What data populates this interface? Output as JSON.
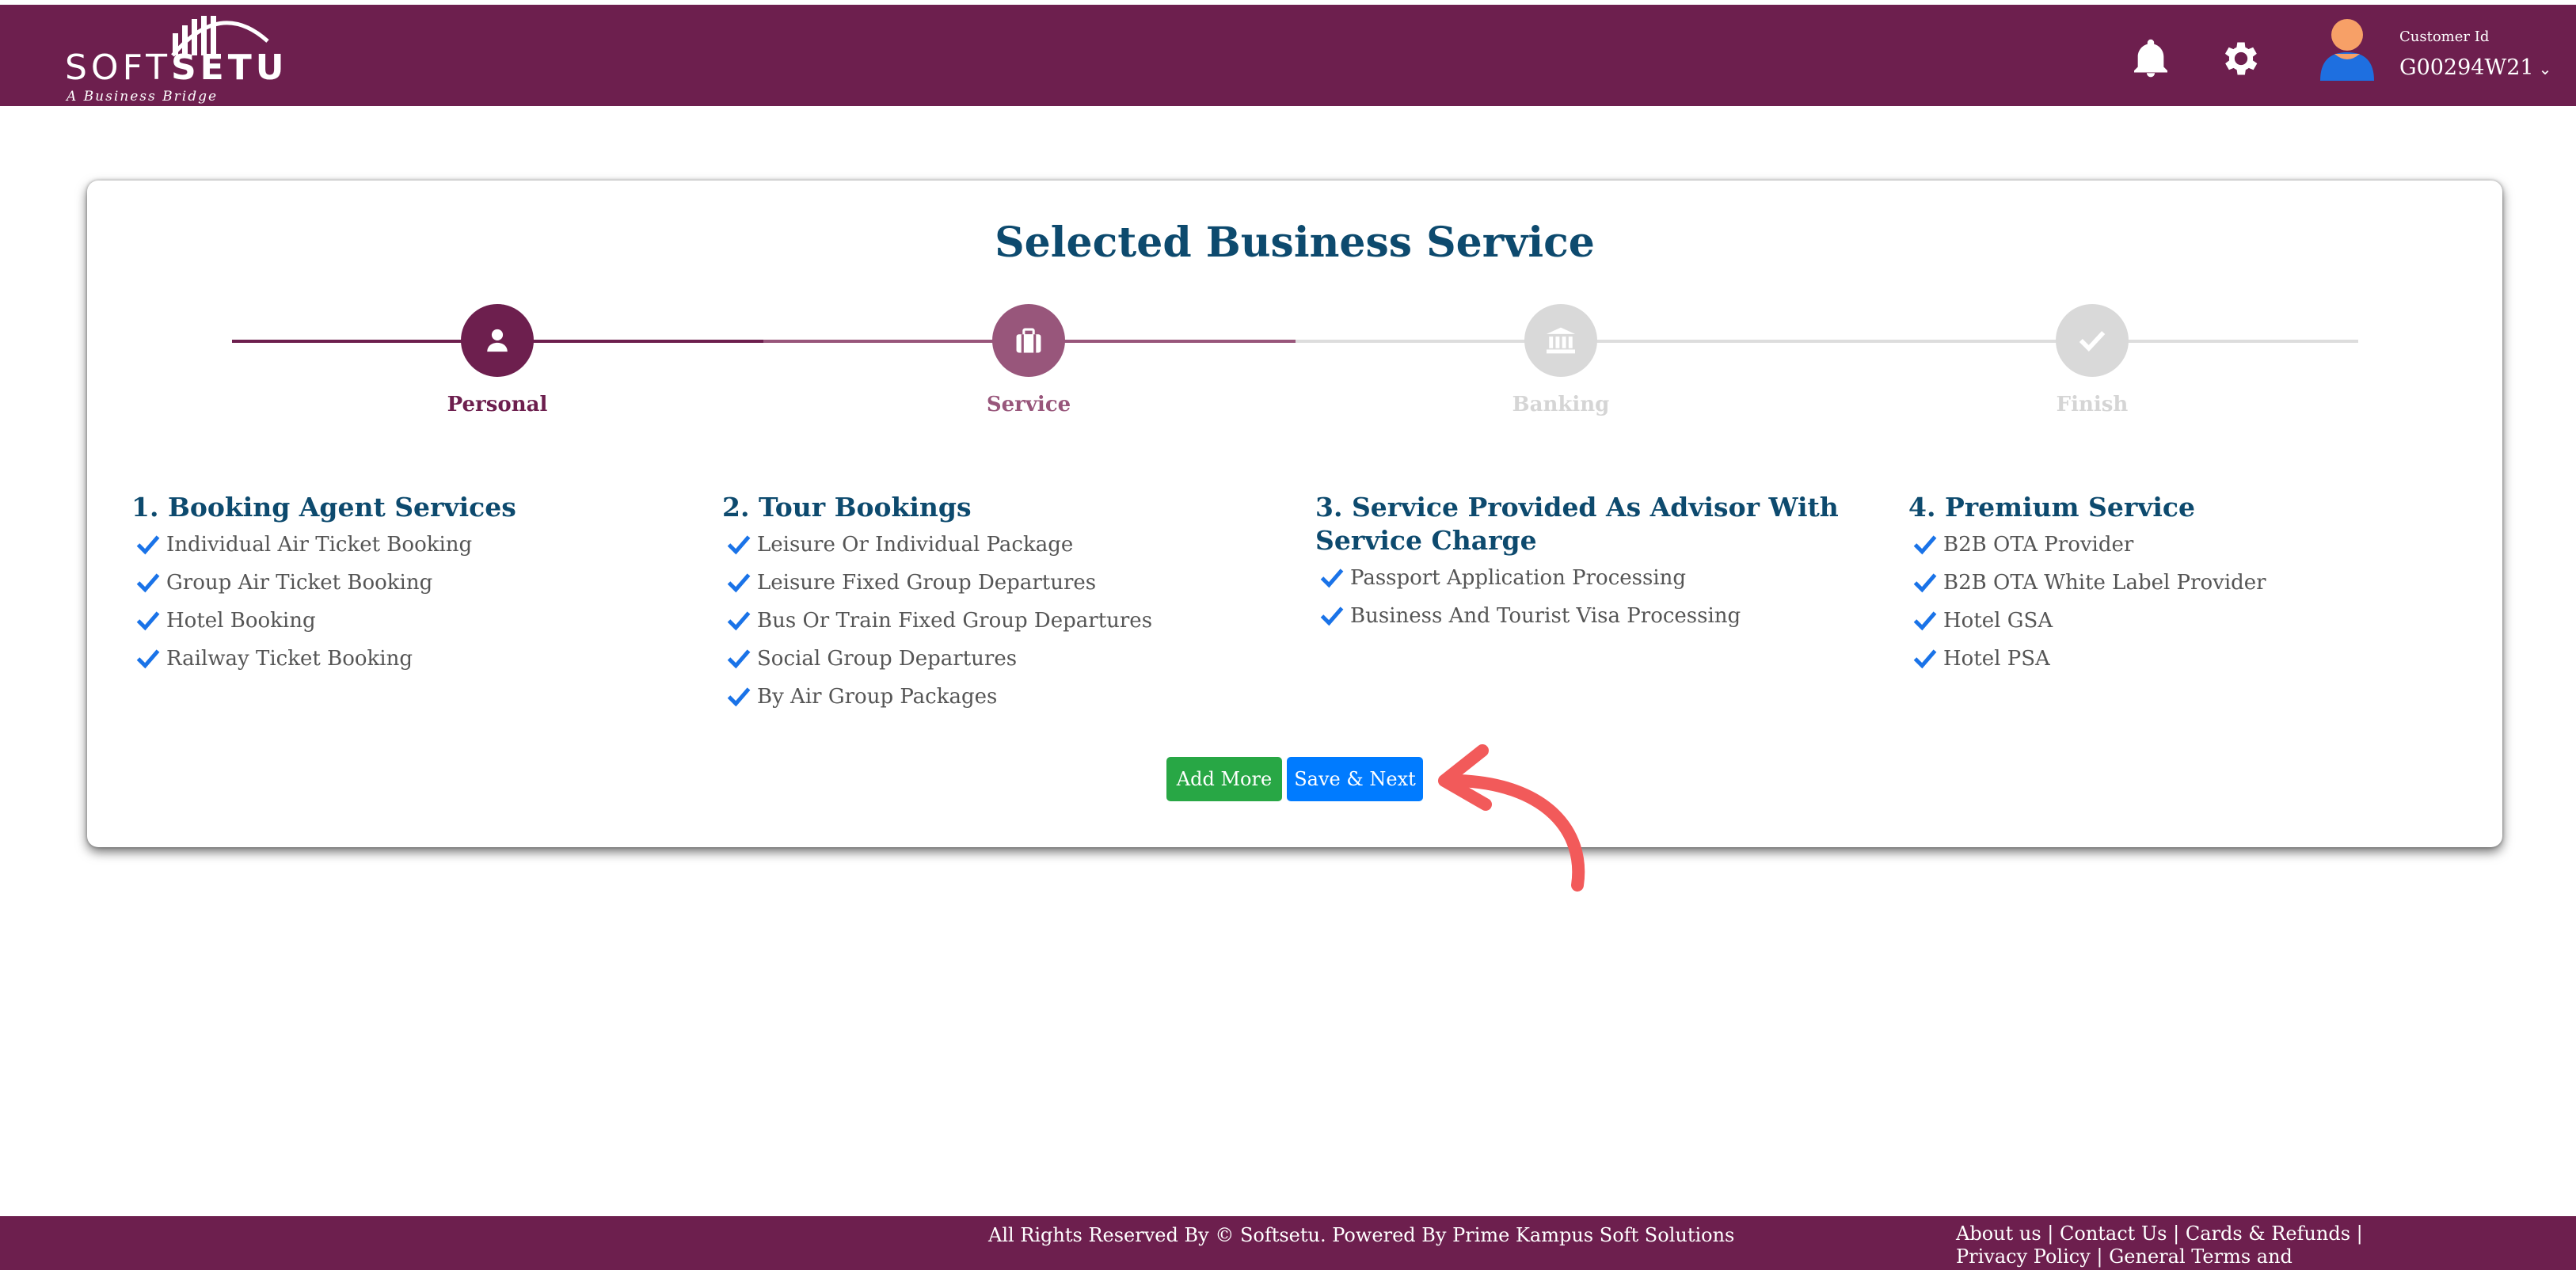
{
  "brand": {
    "logo_soft": "SOFT",
    "logo_setu": "SETU",
    "tagline": "A Business Bridge"
  },
  "header": {
    "icons": {
      "notifications": "bell-icon",
      "settings": "gear-icon",
      "user": "avatar-icon"
    },
    "customer_label": "Customer Id",
    "customer_id": "G00294W21"
  },
  "page": {
    "title": "Selected Business Service"
  },
  "stepper": {
    "steps": [
      {
        "label": "Personal",
        "icon": "user-icon",
        "state": "done"
      },
      {
        "label": "Service",
        "icon": "briefcase-icon",
        "state": "active"
      },
      {
        "label": "Banking",
        "icon": "bank-icon",
        "state": "pending"
      },
      {
        "label": "Finish",
        "icon": "check-icon",
        "state": "pending"
      }
    ]
  },
  "services": [
    {
      "heading": "1. Booking Agent Services",
      "items": [
        "Individual Air Ticket Booking",
        "Group Air Ticket Booking",
        "Hotel Booking",
        "Railway Ticket Booking"
      ]
    },
    {
      "heading": "2. Tour Bookings",
      "items": [
        "Leisure Or Individual Package",
        "Leisure Fixed Group Departures",
        "Bus Or Train Fixed Group Departures",
        "Social Group Departures",
        "By Air Group Packages"
      ]
    },
    {
      "heading": "3. Service Provided As Advisor With Service Charge",
      "items": [
        "Passport Application Processing",
        "Business And Tourist Visa Processing"
      ]
    },
    {
      "heading": "4. Premium Service",
      "items": [
        "B2B OTA Provider",
        "B2B OTA White Label Provider",
        "Hotel GSA",
        "Hotel PSA"
      ]
    }
  ],
  "buttons": {
    "add_more": "Add More",
    "save_next": "Save & Next"
  },
  "footer": {
    "copyright": "All Rights Reserved By © Softsetu. Powered By Prime Kampus Soft Solutions",
    "links": [
      "About us",
      "Contact Us",
      "Cards & Refunds",
      "Privacy Policy",
      "General Terms and Conditions"
    ]
  },
  "colors": {
    "brand": "#6d1f4e",
    "brand_light": "#98567b",
    "heading": "#0d4a6e",
    "check": "#1a73e8",
    "add_button": "#28a745",
    "save_button": "#007bff",
    "annotation_arrow": "#f25a5a"
  }
}
